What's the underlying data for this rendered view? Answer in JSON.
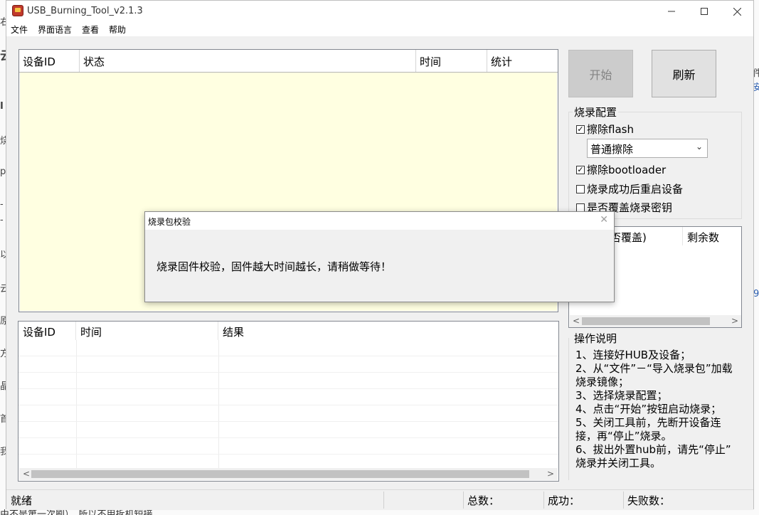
{
  "window": {
    "title": "USB_Burning_Tool_v2.1.3"
  },
  "menu": [
    "文件",
    "界面语言",
    "查看",
    "帮助"
  ],
  "device_table": {
    "headers": [
      "设备ID",
      "状态",
      "时间",
      "统计"
    ]
  },
  "buttons": {
    "start": "开始",
    "refresh": "刷新"
  },
  "burn_config": {
    "title": "烧录配置",
    "erase_flash": {
      "label": "擦除flash",
      "checked": true
    },
    "erase_mode": "普通擦除",
    "erase_bootloader": {
      "label": "擦除bootloader",
      "checked": true
    },
    "reboot_after": {
      "label": "烧录成功后重启设备",
      "checked": false
    },
    "overwrite_key": {
      "label": "是否覆盖烧录密钥",
      "checked": false
    }
  },
  "key_table": {
    "headers": [
      "否覆盖)",
      "剩余数"
    ]
  },
  "result_table": {
    "headers": [
      "设备ID",
      "时间",
      "结果"
    ]
  },
  "instructions": {
    "title": "操作说明",
    "lines": [
      "1、连接好HUB及设备；",
      "2、从“文件”－“导入烧录包”加载",
      "烧录镜像；",
      "3、选择烧录配置；",
      "4、点击“开始”按钮启动烧录；",
      "5、关闭工具前，先断开设备连",
      "接，再“停止”烧录。",
      "6、拔出外置hub前，请先“停止”",
      "烧录并关闭工具。"
    ]
  },
  "status_bar": {
    "ready": "就绪",
    "total": "总数：",
    "success": "成功：",
    "fail": "失败数："
  },
  "dialog": {
    "title": "烧录包校验",
    "message": "烧录固件校验，固件越大时间越长，请稍做等待！"
  },
  "background": {
    "left_glyphs": [
      "右",
      "云",
      "I",
      "烧",
      "p",
      "-",
      "-",
      "以",
      "云",
      "原",
      "方",
      "晶",
      "首",
      "我"
    ],
    "right_glyphs": [
      "件",
      "安",
      "9"
    ],
    "bottom_text": "由不是第一次刷），所以不用拆机短接"
  }
}
